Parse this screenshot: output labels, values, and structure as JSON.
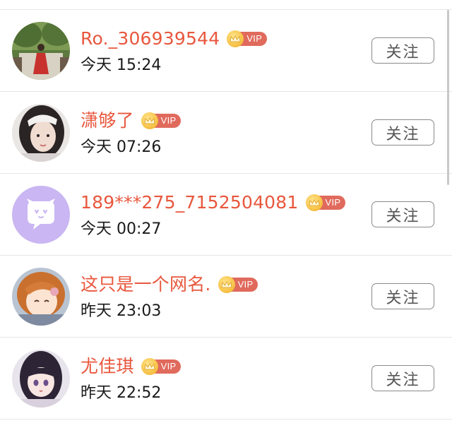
{
  "follow_list": {
    "vip_label": "VIP",
    "follow_label": "关注",
    "items": [
      {
        "name": "Ro._306939544",
        "time": "今天 15:24",
        "avatar": "photo-girl-red-dress"
      },
      {
        "name": "潇够了",
        "time": "今天 07:26",
        "avatar": "photo-girl-selfie"
      },
      {
        "name": "189***275_7152504081",
        "time": "今天 00:27",
        "avatar": "default-chat-bubble-icon"
      },
      {
        "name": "这只是一个网名.",
        "time": "昨天 23:03",
        "avatar": "anime-girl-orange-hair"
      },
      {
        "name": "尤佳琪",
        "time": "昨天 22:52",
        "avatar": "anime-girl-dark-hair"
      }
    ]
  },
  "colors": {
    "name": "#e8573d",
    "vip_tag": "#e06a5c",
    "vip_coin": "#f7c44a",
    "default_avatar_bg": "#c9b6f2"
  }
}
